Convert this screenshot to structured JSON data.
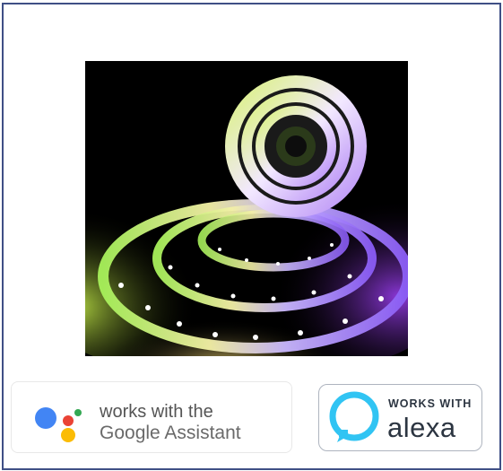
{
  "product_image": {
    "alt": "",
    "subject": "rgb-led-strip-reel"
  },
  "google_badge": {
    "line1": "works with the",
    "line2": "Google Assistant",
    "icon": "google-assistant-icon",
    "colors": {
      "blue": "#4285F4",
      "red": "#EA4335",
      "yellow": "#FBBC05",
      "green": "#34A853"
    }
  },
  "alexa_badge": {
    "line1": "WORKS WITH",
    "line2": "alexa",
    "icon": "alexa-ring-icon",
    "colors": {
      "ring": "#31C4F3",
      "text": "#2C3541"
    }
  },
  "frame_color": "#3F4F85"
}
